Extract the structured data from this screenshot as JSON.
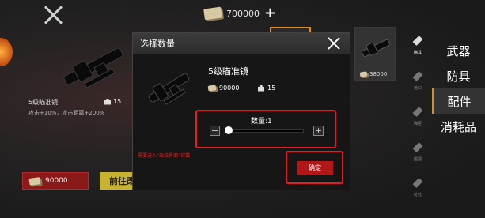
{
  "currency": {
    "amount": "700000",
    "add": "+"
  },
  "left_item": {
    "name": "5级瞄准镜",
    "weight": "15",
    "desc": "攻击+10%，攻击距离+200%",
    "price": "90000",
    "goto_label": "前往改装"
  },
  "grid": {
    "scope_price": "38000"
  },
  "icon_labels": [
    "瞄具",
    "枪口",
    "弹匣",
    "握把",
    "枪托"
  ],
  "categories": [
    {
      "label": "武器",
      "active": false
    },
    {
      "label": "防具",
      "active": false
    },
    {
      "label": "配件",
      "active": true
    },
    {
      "label": "消耗品",
      "active": false
    }
  ],
  "dialog": {
    "title": "选择数量",
    "item_name": "5级瞄准镜",
    "price": "90000",
    "weight": "15",
    "qty_label": "数量:1",
    "quantity": 1,
    "minus": "−",
    "plus": "+",
    "warning": "需要进入“改装界面”穿戴",
    "confirm_label": "确定"
  },
  "colors": {
    "accent_red": "#e02020",
    "highlight_orange": "#e08a20",
    "gold": "#c8b232"
  }
}
